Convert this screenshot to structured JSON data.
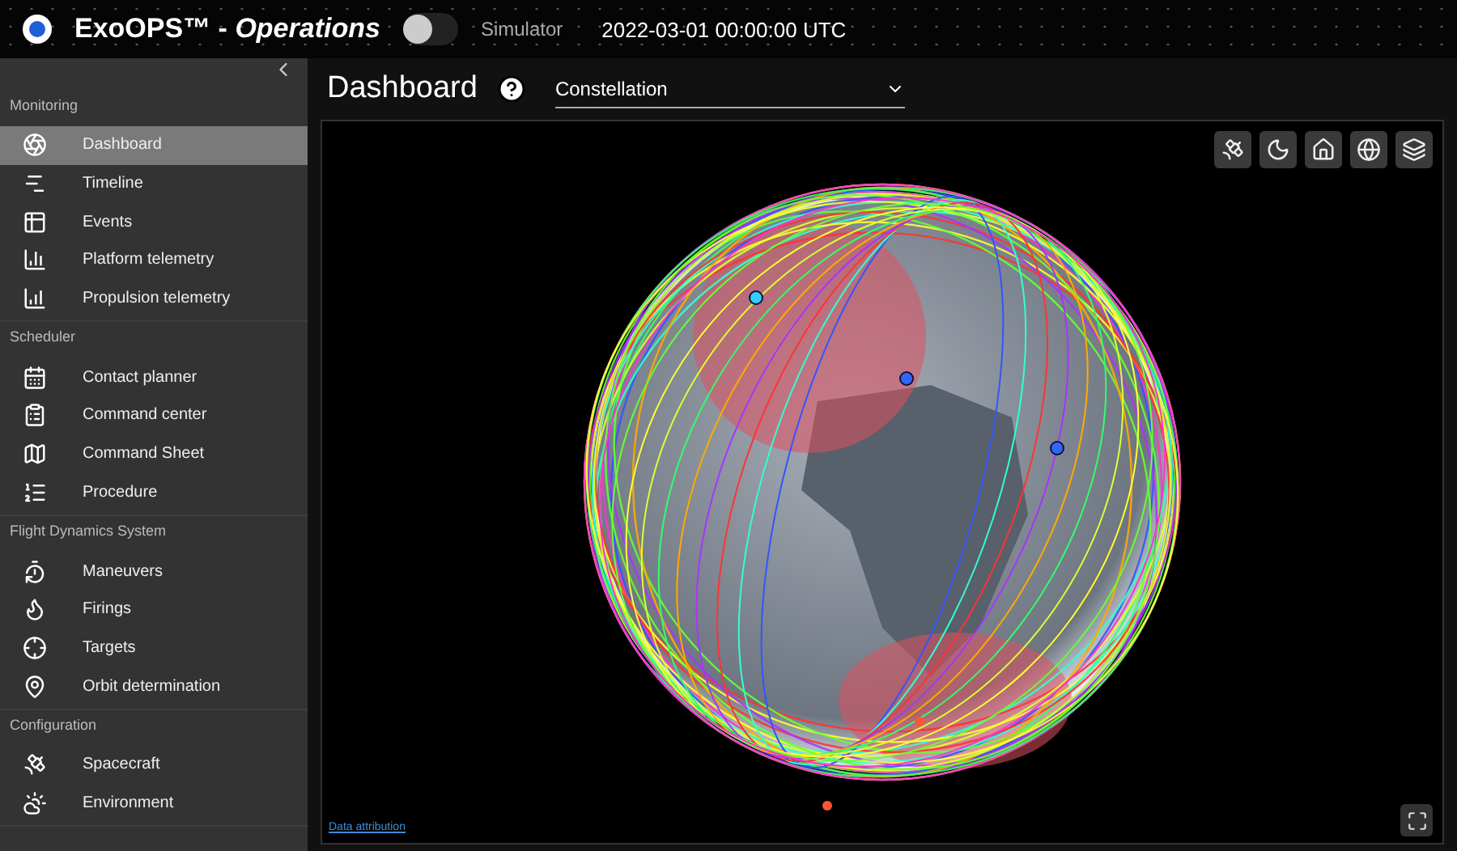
{
  "header": {
    "title": "ExoOPS™ - *Operations*",
    "simulator": {
      "label": "Simulator",
      "on": false
    },
    "datetime": "2022-03-01 00:00:00 UTC"
  },
  "sidebar": {
    "sections": [
      {
        "label": "Monitoring",
        "items": [
          {
            "label": "Dashboard",
            "selected": true
          },
          {
            "label": "Timeline",
            "selected": false
          },
          {
            "label": "Events",
            "selected": false
          },
          {
            "label": "Platform telemetry",
            "selected": false
          },
          {
            "label": "Propulsion telemetry",
            "selected": false
          }
        ]
      },
      {
        "label": "Scheduler",
        "items": [
          {
            "label": "Contact planner",
            "selected": false
          },
          {
            "label": "Command center",
            "selected": false
          },
          {
            "label": "Command Sheet",
            "selected": false
          },
          {
            "label": "Procedure",
            "selected": false
          }
        ]
      },
      {
        "label": "Flight Dynamics System",
        "items": [
          {
            "label": "Maneuvers",
            "selected": false
          },
          {
            "label": "Firings",
            "selected": false
          },
          {
            "label": "Targets",
            "selected": false
          },
          {
            "label": "Orbit determination",
            "selected": false
          }
        ]
      },
      {
        "label": "Configuration",
        "items": [
          {
            "label": "Spacecraft",
            "selected": false
          },
          {
            "label": "Environment",
            "selected": false
          }
        ]
      }
    ]
  },
  "page": {
    "title": "Dashboard",
    "view_select": {
      "value": "Constellation"
    }
  },
  "viewer": {
    "attribution": "Data attribution"
  }
}
